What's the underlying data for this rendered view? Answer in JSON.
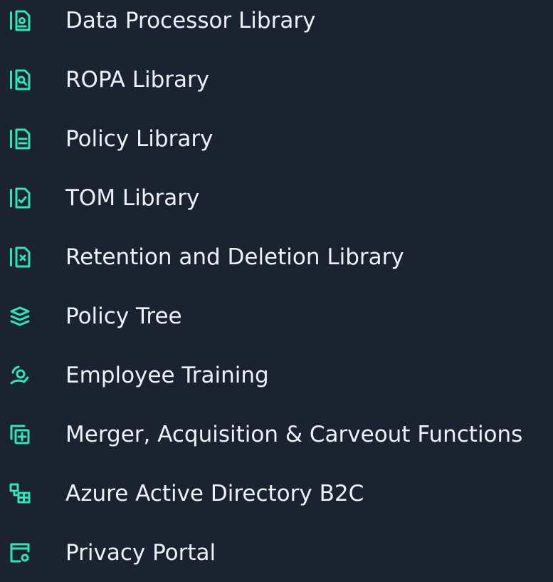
{
  "colors": {
    "background": "#1b2230",
    "text": "#eef1f5",
    "icon": "#2ee6b8"
  },
  "menu": {
    "items": [
      {
        "label": "Data Processor Library",
        "icon": "document-library-icon"
      },
      {
        "label": "ROPA Library",
        "icon": "document-search-icon"
      },
      {
        "label": "Policy Library",
        "icon": "policy-document-icon"
      },
      {
        "label": "TOM Library",
        "icon": "checked-document-icon"
      },
      {
        "label": "Retention and Deletion Library",
        "icon": "delete-document-icon"
      },
      {
        "label": "Policy Tree",
        "icon": "layers-icon"
      },
      {
        "label": "Employee Training",
        "icon": "training-icon"
      },
      {
        "label": "Merger, Acquisition & Carveout Functions",
        "icon": "merge-icon"
      },
      {
        "label": "Azure Active Directory B2C",
        "icon": "directory-icon"
      },
      {
        "label": "Privacy Portal",
        "icon": "portal-icon"
      }
    ]
  }
}
